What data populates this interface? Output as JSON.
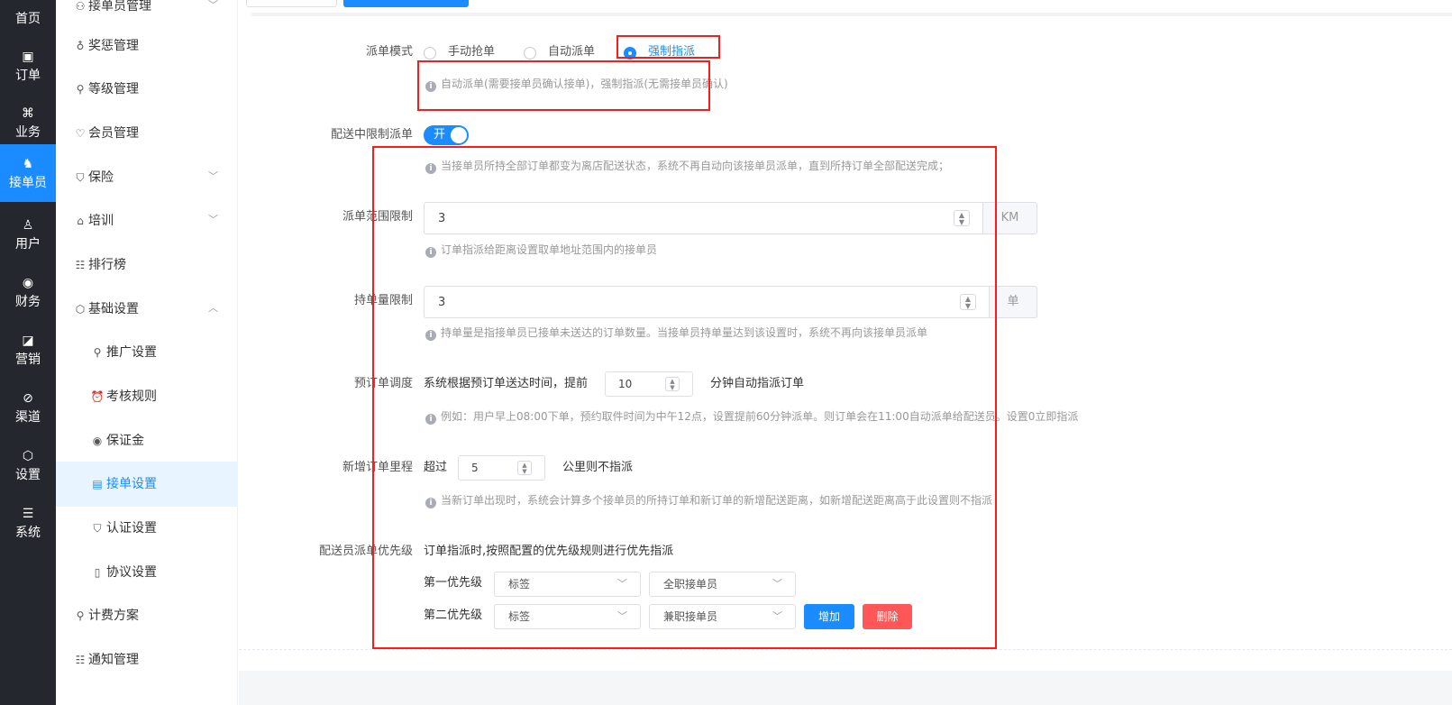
{
  "rail": {
    "items": [
      {
        "label": "首页",
        "icon": "home-icon",
        "glyph": ""
      },
      {
        "label": "订单",
        "icon": "order-icon",
        "glyph": "▣"
      },
      {
        "label": "业务",
        "icon": "business-icon",
        "glyph": "⌘"
      },
      {
        "label": "接单员",
        "icon": "rider-icon",
        "glyph": "♞"
      },
      {
        "label": "用户",
        "icon": "user-icon",
        "glyph": "♙"
      },
      {
        "label": "财务",
        "icon": "finance-icon",
        "glyph": "◉"
      },
      {
        "label": "营销",
        "icon": "marketing-icon",
        "glyph": "◪"
      },
      {
        "label": "渠道",
        "icon": "channel-icon",
        "glyph": "⊘"
      },
      {
        "label": "设置",
        "icon": "settings-icon",
        "glyph": "⬡"
      },
      {
        "label": "系统",
        "icon": "system-icon",
        "glyph": "☰"
      }
    ]
  },
  "submenu": {
    "items": [
      {
        "label": "接单员管理",
        "glyph": "⚇"
      },
      {
        "label": "奖惩管理",
        "glyph": "♁"
      },
      {
        "label": "等级管理",
        "glyph": "⚲"
      },
      {
        "label": "会员管理",
        "glyph": "♡"
      },
      {
        "label": "保险",
        "glyph": "⛉"
      },
      {
        "label": "培训",
        "glyph": "⌂"
      },
      {
        "label": "排行榜",
        "glyph": "☷"
      },
      {
        "label": "基础设置",
        "glyph": "⬡"
      },
      {
        "label": "推广设置",
        "glyph": "⚲"
      },
      {
        "label": "考核规则",
        "glyph": "⏰"
      },
      {
        "label": "保证金",
        "glyph": "◉"
      },
      {
        "label": "接单设置",
        "glyph": "▤"
      },
      {
        "label": "认证设置",
        "glyph": "⛉"
      },
      {
        "label": "协议设置",
        "glyph": "▯"
      },
      {
        "label": "计费方案",
        "glyph": "⚲"
      },
      {
        "label": "通知管理",
        "glyph": "☷"
      }
    ]
  },
  "form": {
    "dispatch_mode": {
      "label": "派单模式",
      "options": [
        "手动抢单",
        "自动派单",
        "强制指派"
      ],
      "selected": "强制指派",
      "hint": "自动派单(需要接单员确认接单)，强制指派(无需接单员确认)"
    },
    "delivery_limit": {
      "label": "配送中限制派单",
      "switch_text": "开",
      "hint": "当接单员所持全部订单都变为离店配送状态，系统不再自动向该接单员派单，直到所持订单全部配送完成；"
    },
    "range_limit": {
      "label": "派单范围限制",
      "value": "3",
      "unit": "KM",
      "hint": "订单指派给距离设置取单地址范围内的接单员"
    },
    "hold_limit": {
      "label": "持单量限制",
      "value": "3",
      "unit": "单",
      "hint": "持单量是指接单员已接单未送达的订单数量。当接单员持单量达到该设置时，系统不再向该接单员派单"
    },
    "preorder": {
      "label": "预订单调度",
      "prefix": "系统根据预订单送达时间，提前",
      "value": "10",
      "suffix": "分钟自动指派订单",
      "hint": "例如：用户早上08:00下单，预约取件时间为中午12点，设置提前60分钟派单。则订单会在11:00自动派单给配送员。设置0立即指派"
    },
    "mileage": {
      "label": "新增订单里程",
      "prefix": "超过",
      "value": "5",
      "suffix": "公里则不指派",
      "hint": "当新订单出现时，系统会计算多个接单员的所持订单和新订单的新增配送距离，如新增配送距离高于此设置则不指派"
    },
    "priority": {
      "label": "配送员派单优先级",
      "desc": "订单指派时,按照配置的优先级规则进行优先指派",
      "rows": [
        {
          "label": "第一优先级",
          "type": "标签",
          "value": "全职接单员"
        },
        {
          "label": "第二优先级",
          "type": "标签",
          "value": "兼职接单员"
        }
      ],
      "add_label": "增加",
      "delete_label": "删除"
    }
  },
  "colors": {
    "accent": "#1a8cff",
    "danger": "#ff5757",
    "annotation": "#ff1a1a",
    "rail": "#24272e"
  }
}
